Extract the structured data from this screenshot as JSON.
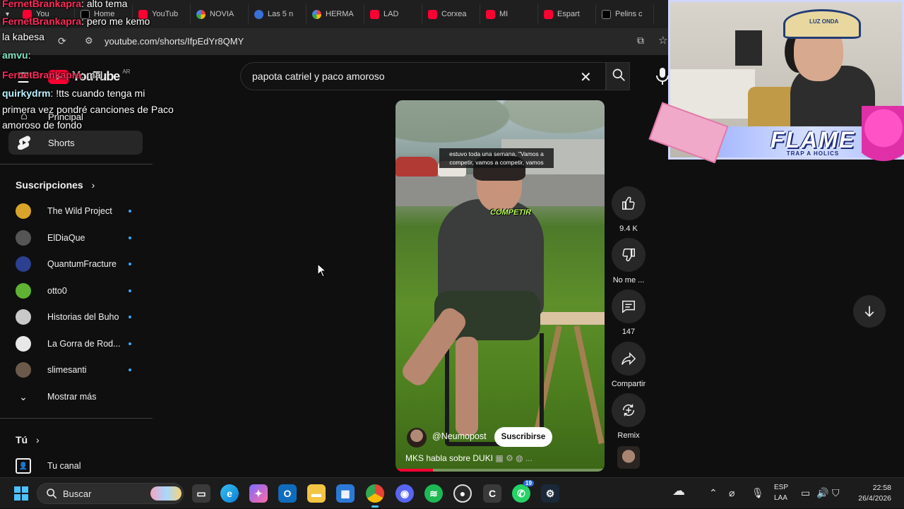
{
  "browser": {
    "tabs": [
      {
        "label": "You",
        "favicon": "youtube-icon"
      },
      {
        "label": "Home",
        "favicon": "x-icon"
      },
      {
        "label": "YouTub",
        "favicon": "youtube-icon"
      },
      {
        "label": "NOVIA",
        "favicon": "google-icon"
      },
      {
        "label": "Las 5 n",
        "favicon": "page-icon"
      },
      {
        "label": "HERMA",
        "favicon": "google-icon"
      },
      {
        "label": "LAD",
        "favicon": "youtube-icon"
      },
      {
        "label": "Corxea",
        "favicon": "youtube-icon"
      },
      {
        "label": "MI",
        "favicon": "youtube-icon"
      },
      {
        "label": "Espart",
        "favicon": "youtube-icon"
      },
      {
        "label": "Pelins c",
        "favicon": "x-icon"
      }
    ],
    "address": "youtube.com/shorts/IfpEdYr8QMY"
  },
  "youtube": {
    "logo_text": "YouTube",
    "logo_region": "AR",
    "search": {
      "value": "papota catriel y paco amoroso"
    },
    "sidebar": {
      "home_label": "Principal",
      "shorts_label": "Shorts",
      "subscriptions_title": "Suscripciones",
      "subscriptions": [
        {
          "label": "The Wild Project",
          "color": "#d8a42a"
        },
        {
          "label": "ElDiaQue",
          "color": "#555555"
        },
        {
          "label": "QuantumFracture",
          "color": "#2d3f8f"
        },
        {
          "label": "otto0",
          "color": "#5fb233"
        },
        {
          "label": "Historias del Buho",
          "color": "#c9c9c9"
        },
        {
          "label": "La Gorra de Rod...",
          "color": "#e8e8e8"
        },
        {
          "label": "slimesanti",
          "color": "#6b5a4a"
        }
      ],
      "show_more": "Mostrar más",
      "you_title": "Tú",
      "your_channel": "Tu canal"
    },
    "short": {
      "caption": "estuvo toda una semana, \"Vamos a competir, vamos a competir, vamos",
      "overlay_word": "COMPETIR",
      "channel_handle": "@Neumopost",
      "subscribe_label": "Suscribirse",
      "title": "MKS habla sobre DUKI",
      "progress": 0.18,
      "likes": "9.4 K",
      "dislike_label": "No me ...",
      "comments": "147",
      "share_label": "Compartir",
      "remix_label": "Remix"
    }
  },
  "chat": [
    {
      "user": "FernetBrankapra",
      "user_color": "#ff2a5a",
      "text": ": alto tema"
    },
    {
      "user": "FernetBrankapra",
      "user_color": "#ff2a5a",
      "text": ": pero me kemo"
    },
    {
      "user": "",
      "user_color": "#ffffff",
      "text": "la kabesa"
    },
    {
      "user": "amvu",
      "user_color": "#7ee3c4",
      "text": ":"
    },
    {
      "user": "FernetBrankapra",
      "user_color": "#ff2a5a",
      "text": ": mal"
    },
    {
      "user": "quirkydrm",
      "user_color": "#b9f0ff",
      "text": ": !tts cuando tenga mi"
    },
    {
      "user": "",
      "user_color": "#ffffff",
      "text": "primera vez pondré canciones de Paco"
    },
    {
      "user": "",
      "user_color": "#ffffff",
      "text": "amoroso de fondo"
    }
  ],
  "stream_overlay": {
    "banner_title": "FLAME",
    "banner_sub": "TRAP A HOLICS",
    "cap_text": "LUZ ONDA"
  },
  "taskbar": {
    "search_label": "Buscar",
    "language_top": "ESP",
    "language_bottom": "LAA",
    "time": "22:58",
    "date": "26/4/2026",
    "whatsapp_badge": "19"
  }
}
